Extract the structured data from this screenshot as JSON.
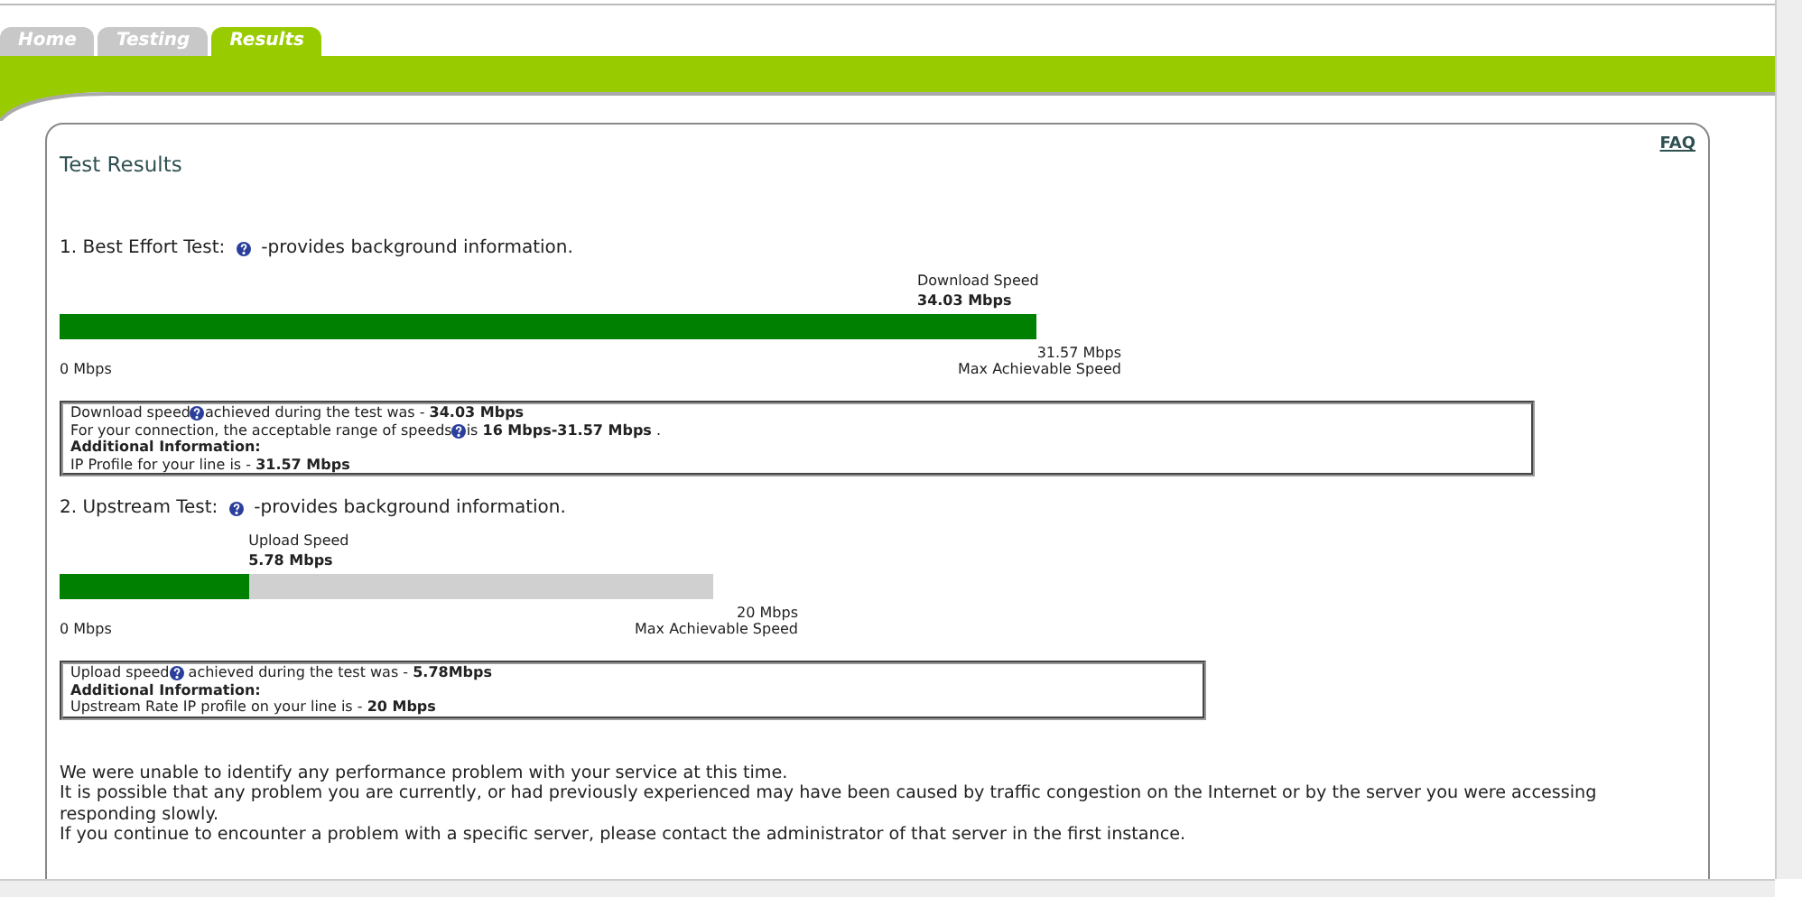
{
  "tabs": [
    {
      "label": "Home",
      "selected": false
    },
    {
      "label": "Testing",
      "selected": false
    },
    {
      "label": "Results",
      "selected": true
    }
  ],
  "title": "Test Results",
  "faq": "FAQ",
  "tests": [
    {
      "heading": "1. Best Effort Test:",
      "note": "-provides background information.",
      "speed_label": "Download Speed",
      "speed_value": "34.03 Mbps",
      "level": 1,
      "min_label": "0 Mbps",
      "max_label": "31.57 Mbps",
      "max_caption": "Max Achievable Speed",
      "info": [
        {
          "kind": "text",
          "before": "Download speed",
          "help": true,
          "after": "achieved during the test was - **34.03 Mbps**"
        },
        {
          "kind": "text",
          "before": "For your connection, the acceptable range of speeds",
          "help": true,
          "after": "is **16 Mbps-31.57 Mbps** ."
        },
        {
          "kind": "heading",
          "before": "Additional Information:",
          "help": false
        },
        {
          "kind": "text",
          "before": "IP Profile for your line is - **31.57 Mbps**",
          "help": false
        }
      ]
    },
    {
      "heading": "2. Upstream Test:",
      "note": "-provides background information.",
      "speed_label": "Upload Speed",
      "speed_value": "5.78 Mbps",
      "level": 0.289,
      "min_label": "0 Mbps",
      "max_label": "20 Mbps",
      "max_caption": "Max Achievable Speed",
      "info": [
        {
          "kind": "text",
          "before": "Upload speed",
          "help": true,
          "after": " achieved during the test was - **5.78Mbps**"
        },
        {
          "kind": "heading",
          "before": "Additional Information:",
          "help": false
        },
        {
          "kind": "text",
          "before": "Upstream Rate IP profile on your line is - **20 Mbps**",
          "help": false
        }
      ]
    }
  ],
  "messages": [
    "We were unable to identify any performance problem with your service at this time.",
    "It is possible that any problem you are currently, or had previously experienced may have been caused by traffic congestion on the Internet or by the server you were accessing responding slowly.",
    "If you continue to encounter a problem with a specific server, please contact the administrator of that server in the first instance."
  ]
}
